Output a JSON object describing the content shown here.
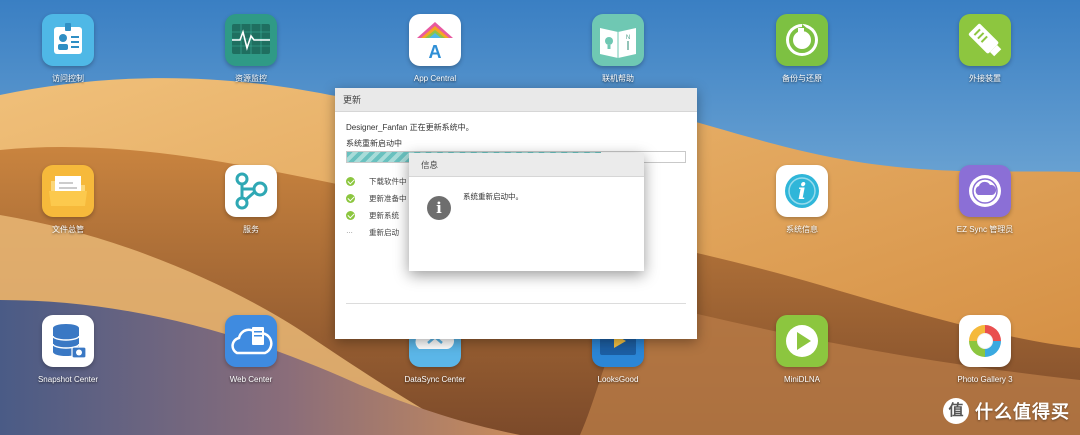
{
  "desktop": {
    "apps": [
      {
        "label": "访问控制",
        "icon": "access-control-icon"
      },
      {
        "label": "资源监控",
        "icon": "resource-monitor-icon"
      },
      {
        "label": "App Central",
        "icon": "app-central-icon"
      },
      {
        "label": "联机帮助",
        "icon": "online-help-icon"
      },
      {
        "label": "备份与还原",
        "icon": "backup-restore-icon"
      },
      {
        "label": "外接装置",
        "icon": "external-device-icon"
      },
      {
        "label": "文件总管",
        "icon": "file-explorer-icon"
      },
      {
        "label": "服务",
        "icon": "services-icon"
      },
      {
        "label": "系统信息",
        "icon": "system-info-icon"
      },
      {
        "label": "EZ Sync 管理员",
        "icon": "ez-sync-icon"
      },
      {
        "label": "Snapshot Center",
        "icon": "snapshot-center-icon"
      },
      {
        "label": "Web Center",
        "icon": "web-center-icon"
      },
      {
        "label": "DataSync Center",
        "icon": "datasync-center-icon"
      },
      {
        "label": "LooksGood",
        "icon": "looksgood-icon"
      },
      {
        "label": "MiniDLNA",
        "icon": "minidlna-icon"
      },
      {
        "label": "Photo Gallery 3",
        "icon": "photo-gallery-icon"
      }
    ]
  },
  "update_dialog": {
    "title": "更新",
    "status_line": "Designer_Fanfan 正在更新系统中。",
    "substatus": "系统重新启动中",
    "progress_percent": 75,
    "steps": [
      {
        "label": "下载软件中",
        "state": "done"
      },
      {
        "label": "更新准备中",
        "state": "done"
      },
      {
        "label": "更新系统",
        "state": "done"
      },
      {
        "label": "重新启动",
        "state": "pending",
        "indicator": "···"
      }
    ]
  },
  "info_dialog": {
    "title": "信息",
    "message": "系统重新启动中。",
    "icon": "info-icon"
  },
  "watermark": {
    "text": "什么值得买",
    "logo": "smzdm-logo"
  },
  "colors": {
    "progress_stripe": "#69c1bf",
    "step_done": "#8cc63f",
    "sky": "#3f86c6",
    "dune": "#d99a4c"
  }
}
